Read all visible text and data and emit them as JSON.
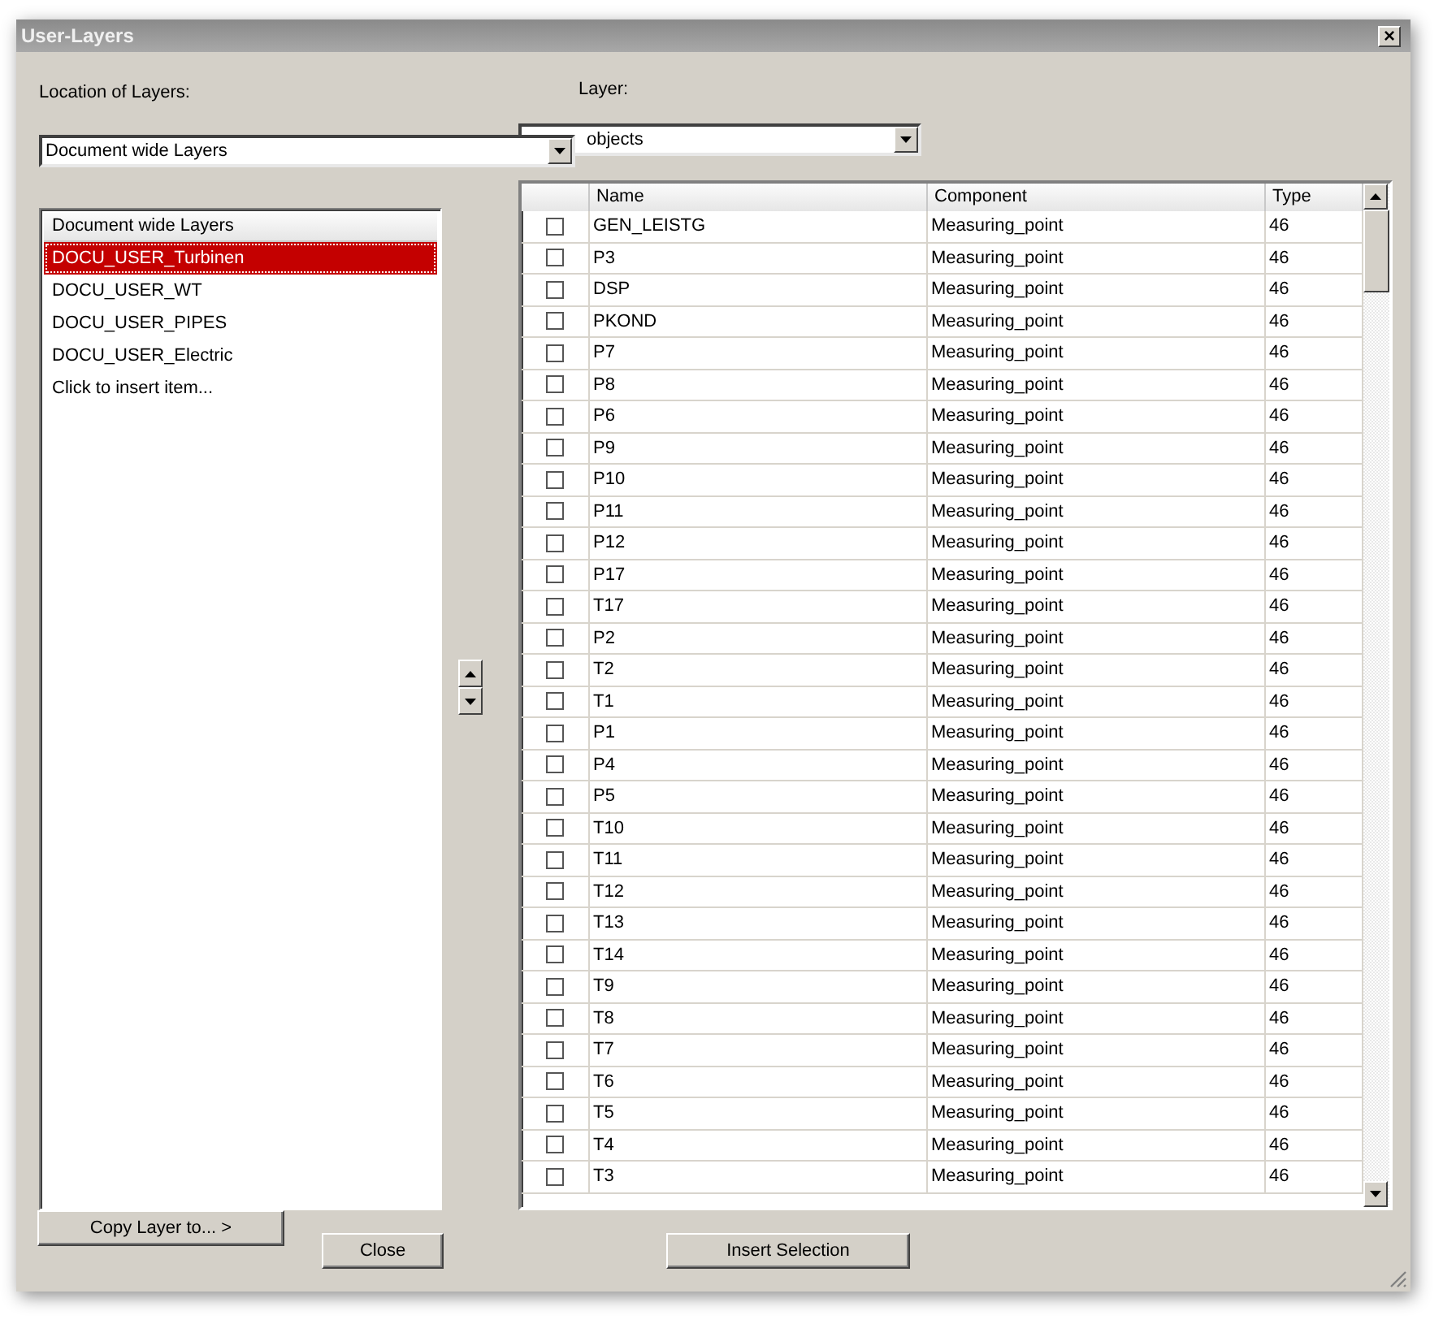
{
  "window": {
    "title": "User-Layers",
    "close": "×"
  },
  "location": {
    "label": "Location of Layers:",
    "value": "Document wide Layers"
  },
  "layer": {
    "label": "Layer:",
    "value": "objects"
  },
  "layers_list": {
    "header": "Document wide Layers",
    "items": [
      {
        "label": "DOCU_USER_Turbinen",
        "selected": true
      },
      {
        "label": "DOCU_USER_WT",
        "selected": false
      },
      {
        "label": "DOCU_USER_PIPES",
        "selected": false
      },
      {
        "label": "DOCU_USER_Electric",
        "selected": false
      },
      {
        "label": "Click to insert item...",
        "selected": false
      }
    ]
  },
  "table": {
    "columns": [
      "Name",
      "Component",
      "Type"
    ],
    "rows": [
      {
        "name": "GEN_LEISTG",
        "component": "Measuring_point",
        "type": "46",
        "checked": false
      },
      {
        "name": "P3",
        "component": "Measuring_point",
        "type": "46",
        "checked": false
      },
      {
        "name": "DSP",
        "component": "Measuring_point",
        "type": "46",
        "checked": false
      },
      {
        "name": "PKOND",
        "component": "Measuring_point",
        "type": "46",
        "checked": false
      },
      {
        "name": "P7",
        "component": "Measuring_point",
        "type": "46",
        "checked": false
      },
      {
        "name": "P8",
        "component": "Measuring_point",
        "type": "46",
        "checked": false
      },
      {
        "name": "P6",
        "component": "Measuring_point",
        "type": "46",
        "checked": false
      },
      {
        "name": "P9",
        "component": "Measuring_point",
        "type": "46",
        "checked": false
      },
      {
        "name": "P10",
        "component": "Measuring_point",
        "type": "46",
        "checked": false
      },
      {
        "name": "P11",
        "component": "Measuring_point",
        "type": "46",
        "checked": false
      },
      {
        "name": "P12",
        "component": "Measuring_point",
        "type": "46",
        "checked": false
      },
      {
        "name": "P17",
        "component": "Measuring_point",
        "type": "46",
        "checked": false
      },
      {
        "name": "T17",
        "component": "Measuring_point",
        "type": "46",
        "checked": false
      },
      {
        "name": "P2",
        "component": "Measuring_point",
        "type": "46",
        "checked": false
      },
      {
        "name": "T2",
        "component": "Measuring_point",
        "type": "46",
        "checked": false
      },
      {
        "name": "T1",
        "component": "Measuring_point",
        "type": "46",
        "checked": false
      },
      {
        "name": "P1",
        "component": "Measuring_point",
        "type": "46",
        "checked": false
      },
      {
        "name": "P4",
        "component": "Measuring_point",
        "type": "46",
        "checked": false
      },
      {
        "name": "P5",
        "component": "Measuring_point",
        "type": "46",
        "checked": false
      },
      {
        "name": "T10",
        "component": "Measuring_point",
        "type": "46",
        "checked": false
      },
      {
        "name": "T11",
        "component": "Measuring_point",
        "type": "46",
        "checked": false
      },
      {
        "name": "T12",
        "component": "Measuring_point",
        "type": "46",
        "checked": false
      },
      {
        "name": "T13",
        "component": "Measuring_point",
        "type": "46",
        "checked": false
      },
      {
        "name": "T14",
        "component": "Measuring_point",
        "type": "46",
        "checked": false
      },
      {
        "name": "T9",
        "component": "Measuring_point",
        "type": "46",
        "checked": false
      },
      {
        "name": "T8",
        "component": "Measuring_point",
        "type": "46",
        "checked": false
      },
      {
        "name": "T7",
        "component": "Measuring_point",
        "type": "46",
        "checked": false
      },
      {
        "name": "T6",
        "component": "Measuring_point",
        "type": "46",
        "checked": false
      },
      {
        "name": "T5",
        "component": "Measuring_point",
        "type": "46",
        "checked": false
      },
      {
        "name": "T4",
        "component": "Measuring_point",
        "type": "46",
        "checked": false
      },
      {
        "name": "T3",
        "component": "Measuring_point",
        "type": "46",
        "checked": false
      }
    ]
  },
  "buttons": {
    "copy": "Copy Layer to... >",
    "close": "Close",
    "insert": "Insert Selection"
  }
}
